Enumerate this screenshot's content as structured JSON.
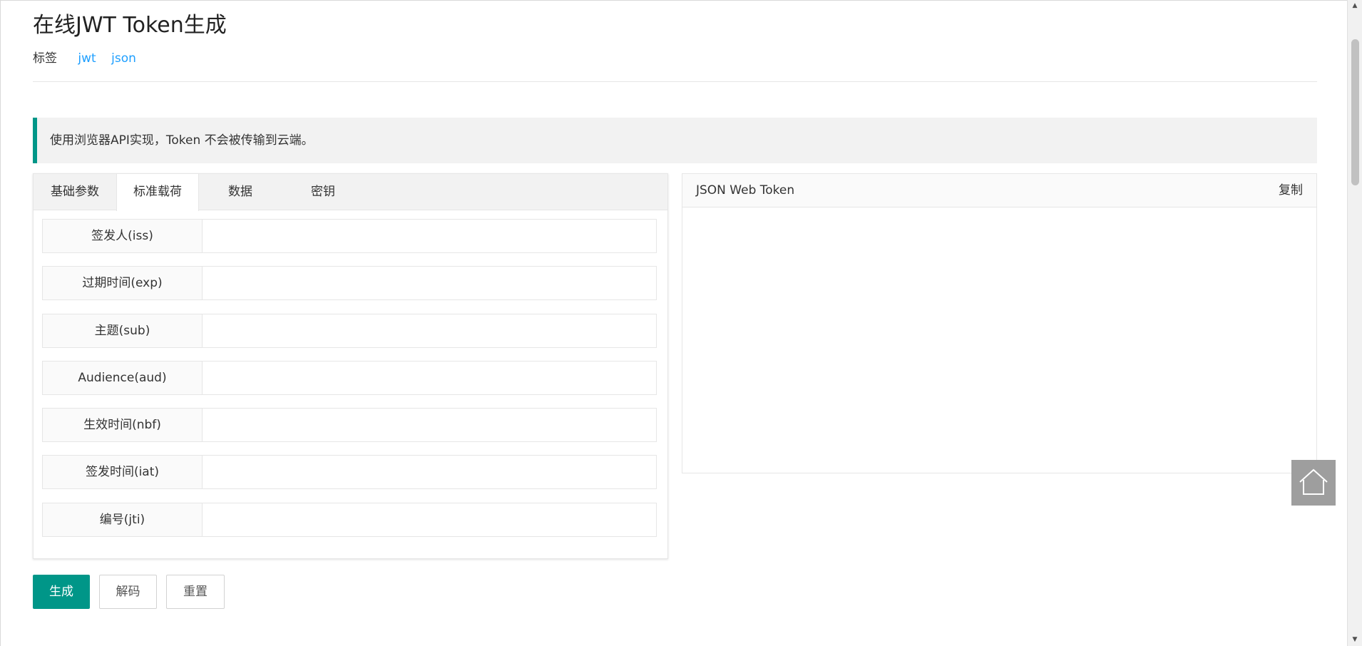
{
  "page": {
    "title": "在线JWT Token生成",
    "tags_label": "标签",
    "tags": [
      "jwt",
      "json"
    ],
    "notice": "使用浏览器API实现，Token 不会被传输到云端。"
  },
  "tabs": [
    {
      "label": "基础参数",
      "active": false
    },
    {
      "label": "标准载荷",
      "active": true
    },
    {
      "label": "数据",
      "active": false
    },
    {
      "label": "密钥",
      "active": false
    }
  ],
  "payload_fields": [
    {
      "label": "签发人(iss)",
      "value": ""
    },
    {
      "label": "过期时间(exp)",
      "value": ""
    },
    {
      "label": "主题(sub)",
      "value": ""
    },
    {
      "label": "Audience(aud)",
      "value": ""
    },
    {
      "label": "生效时间(nbf)",
      "value": ""
    },
    {
      "label": "签发时间(iat)",
      "value": ""
    },
    {
      "label": "编号(jti)",
      "value": ""
    }
  ],
  "output": {
    "title": "JSON Web Token",
    "copy_label": "复制",
    "value": ""
  },
  "actions": {
    "generate_label": "生成",
    "decode_label": "解码",
    "reset_label": "重置"
  },
  "colors": {
    "accent": "#009688",
    "link": "#1e9fff",
    "notice_bg": "#f2f2f2"
  },
  "icons": {
    "home": "home-icon"
  }
}
